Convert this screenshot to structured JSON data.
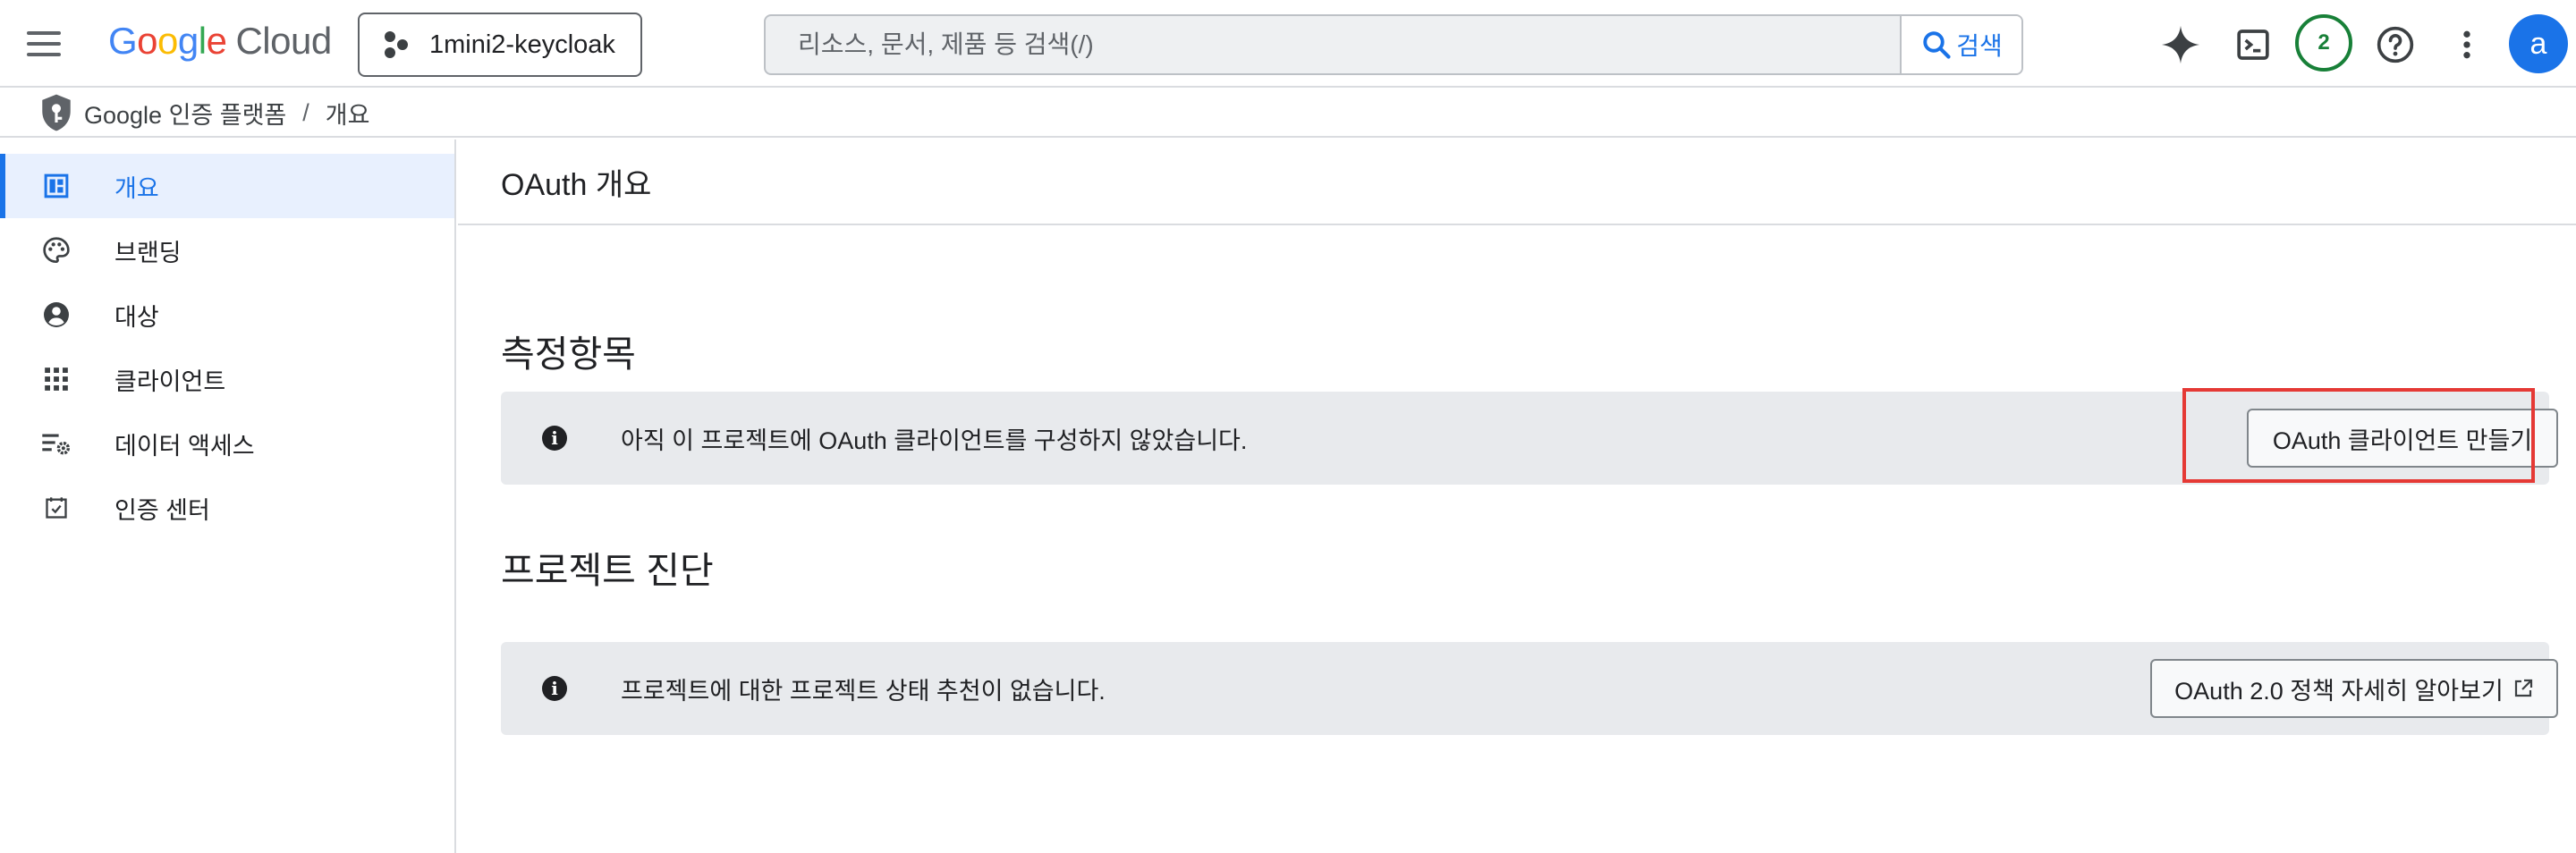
{
  "header": {
    "logo": {
      "google": [
        "G",
        "o",
        "o",
        "g",
        "l",
        "e"
      ],
      "cloud": "Cloud"
    },
    "project_name": "1mini2-keycloak",
    "search_placeholder": "리소스, 문서, 제품 등 검색(/)",
    "search_button_label": "검색",
    "notification_count": "2",
    "avatar_letter": "a"
  },
  "breadcrumb": {
    "product": "Google 인증 플랫폼",
    "separator": "/",
    "current": "개요"
  },
  "sidebar": {
    "items": [
      {
        "label": "개요",
        "icon": "dashboard-icon",
        "active": true
      },
      {
        "label": "브랜딩",
        "icon": "palette-icon",
        "active": false
      },
      {
        "label": "대상",
        "icon": "account-circle-icon",
        "active": false
      },
      {
        "label": "클라이언트",
        "icon": "apps-grid-icon",
        "active": false
      },
      {
        "label": "데이터 액세스",
        "icon": "data-settings-icon",
        "active": false
      },
      {
        "label": "인증 센터",
        "icon": "verified-calendar-icon",
        "active": false
      }
    ]
  },
  "main": {
    "title": "OAuth 개요",
    "metrics": {
      "title": "측정항목",
      "message": "아직 이 프로젝트에 OAuth 클라이언트를 구성하지 않았습니다.",
      "button_label": "OAuth 클라이언트 만들기"
    },
    "diagnostics": {
      "title": "프로젝트 진단",
      "message": "프로젝트에 대한 프로젝트 상태 추천이 없습니다.",
      "button_label": "OAuth 2.0 정책 자세히 알아보기"
    }
  },
  "colors": {
    "accent": "#1a73e8",
    "highlight": "#e53935",
    "success": "#188038",
    "banner_bg": "#e8eaed"
  }
}
